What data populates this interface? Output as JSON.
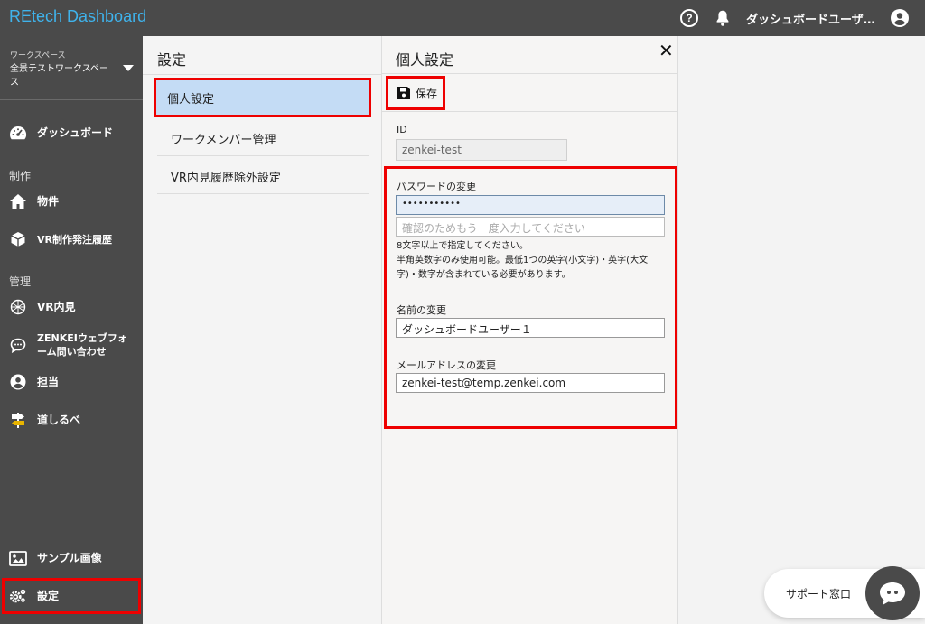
{
  "app": {
    "title": "REtech Dashboard"
  },
  "topbar": {
    "user_name": "ダッシュボードユーザ…"
  },
  "sidebar": {
    "workspace_caption": "ワークスペース",
    "workspace_name": "全景テストワークスペース",
    "sections": {
      "production": "制作",
      "management": "管理"
    },
    "items": [
      {
        "label": "ダッシュボード",
        "icon": "dashboard-gauge-icon"
      },
      {
        "label": "物件",
        "icon": "home-icon"
      },
      {
        "label": "VR制作発注履歴",
        "icon": "cube-icon"
      },
      {
        "label": "VR内見",
        "icon": "vr-globe-icon"
      },
      {
        "label": "ZENKEIウェブフォーム問い合わせ",
        "icon": "chat-icon"
      },
      {
        "label": "担当",
        "icon": "person-icon"
      },
      {
        "label": "道しるべ",
        "icon": "signpost-icon"
      },
      {
        "label": "サンプル画像",
        "icon": "image-icon"
      },
      {
        "label": "設定",
        "icon": "gears-icon"
      }
    ]
  },
  "settings": {
    "title": "設定",
    "items": [
      {
        "label": "個人設定"
      },
      {
        "label": "ワークメンバー管理"
      },
      {
        "label": "VR内見履歴除外設定"
      }
    ]
  },
  "personal": {
    "title": "個人設定",
    "save_label": "保存",
    "id_label": "ID",
    "id_value": "zenkei-test",
    "password_label": "パスワードの変更",
    "password_value": "•••••••••••",
    "password_confirm_placeholder": "確認のためもう一度入力してください",
    "hint_line1": "8文字以上で指定してください。",
    "hint_line2": "半角英数字のみ使用可能。最低1つの英字(小文字)・英字(大文字)・数字が含まれている必要があります。",
    "name_label": "名前の変更",
    "name_value": "ダッシュボードユーザー１",
    "email_label": "メールアドレスの変更",
    "email_value": "zenkei-test@temp.zenkei.com"
  },
  "support": {
    "label": "サポート窓口"
  },
  "colors": {
    "accent": "#3fb3ec",
    "sidebar": "#4a4a4a",
    "highlight": "#e00000",
    "active_item": "#c4dcf5"
  }
}
